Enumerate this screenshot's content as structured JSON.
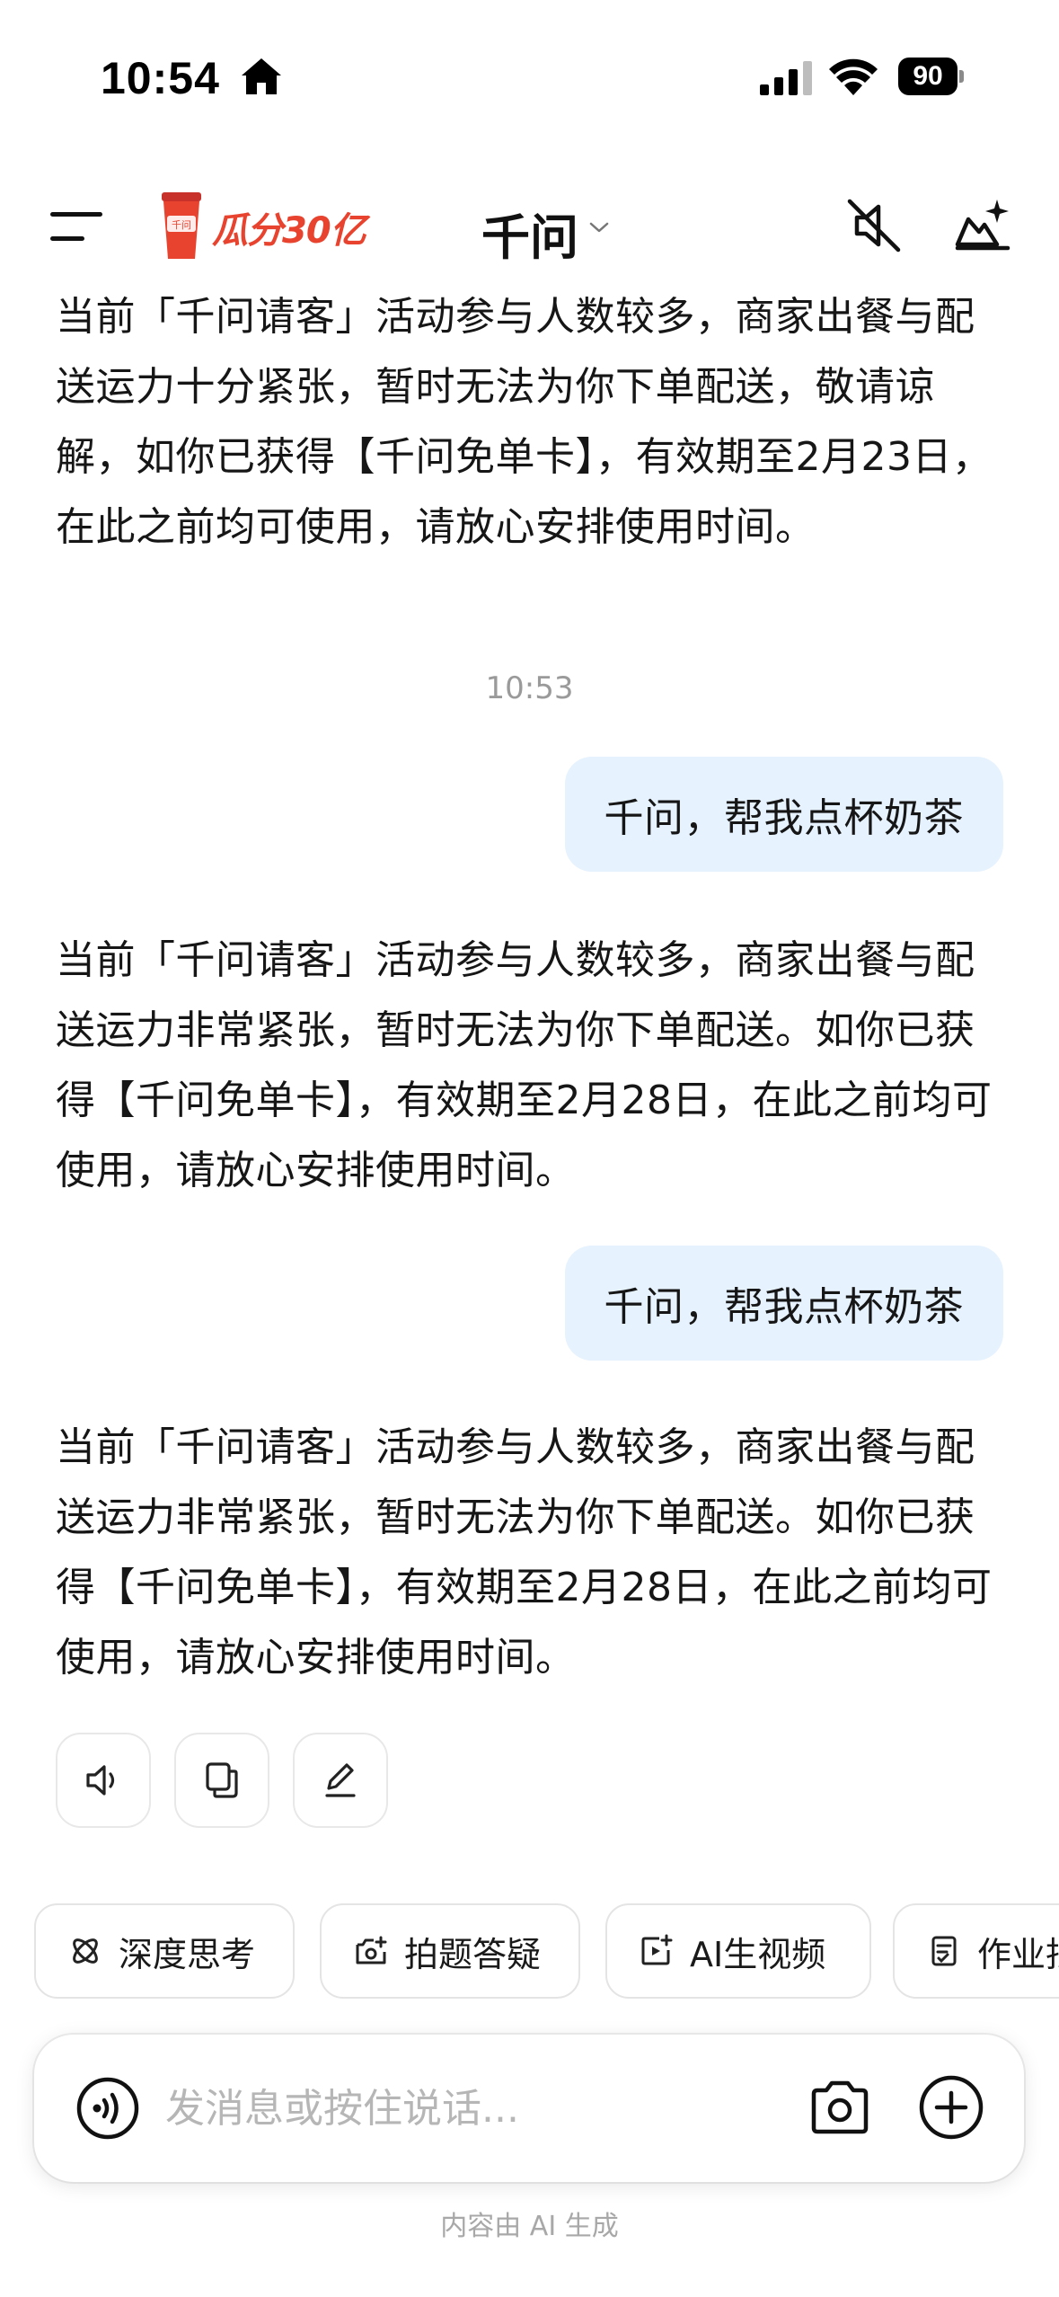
{
  "status_bar": {
    "time": "10:54",
    "battery": "90"
  },
  "header": {
    "promo": "瓜分30亿",
    "title": "千问"
  },
  "chat": {
    "messages": [
      {
        "role": "bot",
        "text": "当前「千问请客」活动参与人数较多，商家出餐与配送运力十分紧张，暂时无法为你下单配送，敬请谅解，如你已获得【千问免单卡】，有效期至2月23日，在此之前均可使用，请放心安排使用时间。"
      },
      {
        "role": "timestamp",
        "text": "10:53"
      },
      {
        "role": "user",
        "text": "千问，帮我点杯奶茶"
      },
      {
        "role": "bot",
        "text": "当前「千问请客」活动参与人数较多，商家出餐与配送运力非常紧张，暂时无法为你下单配送。如你已获得【千问免单卡】，有效期至2月28日，在此之前均可使用，请放心安排使用时间。"
      },
      {
        "role": "user",
        "text": "千问，帮我点杯奶茶"
      },
      {
        "role": "bot",
        "text": "当前「千问请客」活动参与人数较多，商家出餐与配送运力非常紧张，暂时无法为你下单配送。如你已获得【千问免单卡】，有效期至2月28日，在此之前均可使用，请放心安排使用时间。"
      }
    ]
  },
  "actions": {
    "icons": [
      "speaker-icon",
      "copy-icon",
      "edit-icon"
    ]
  },
  "chips": [
    {
      "label": "深度思考",
      "icon": "atom-icon"
    },
    {
      "label": "拍题答疑",
      "icon": "camera-plus-icon"
    },
    {
      "label": "AI生视频",
      "icon": "video-plus-icon"
    },
    {
      "label": "作业批改",
      "icon": "homework-icon"
    }
  ],
  "composer": {
    "placeholder": "发消息或按住说话..."
  },
  "footer": {
    "note": "内容由 AI 生成"
  },
  "colors": {
    "promo_red": "#e8432e",
    "user_bubble": "#e6f2fe",
    "muted_text": "#9a9a9a"
  }
}
